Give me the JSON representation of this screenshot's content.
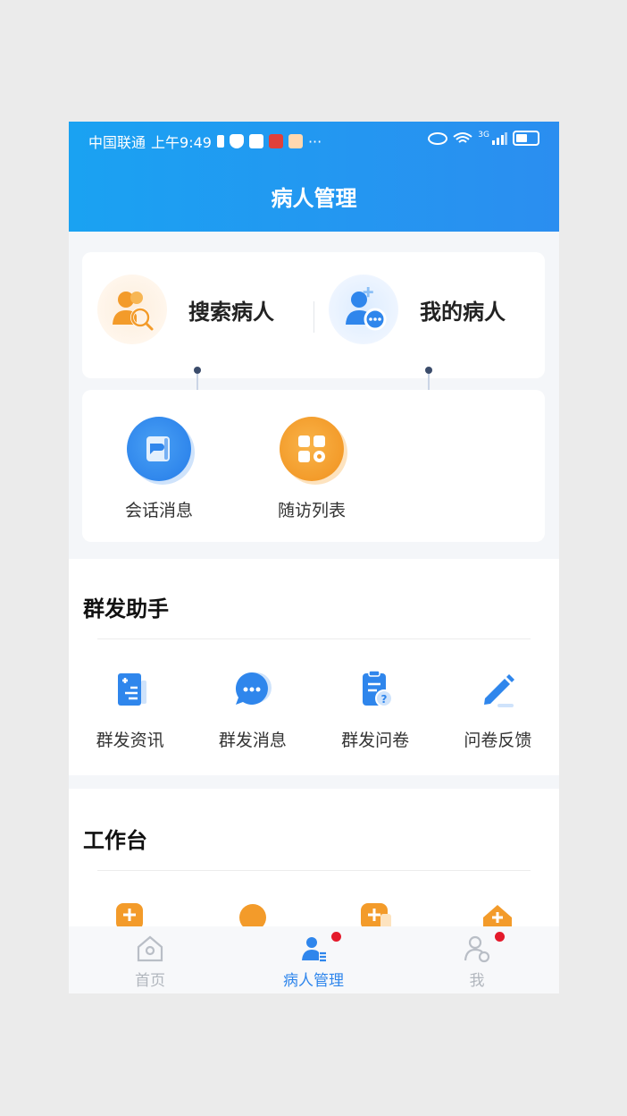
{
  "status_bar": {
    "carrier": "中国联通",
    "time": "上午9:49",
    "more": "···",
    "network": "3G"
  },
  "header": {
    "title": "病人管理"
  },
  "quick": {
    "search_patient": "搜索病人",
    "my_patients": "我的病人",
    "conversation": "会话消息",
    "followup_list": "随访列表"
  },
  "mass": {
    "title": "群发助手",
    "items": [
      {
        "label": "群发资讯",
        "icon": "document-list-icon"
      },
      {
        "label": "群发消息",
        "icon": "chat-bubble-icon"
      },
      {
        "label": "群发问卷",
        "icon": "clipboard-question-icon"
      },
      {
        "label": "问卷反馈",
        "icon": "pencil-icon"
      }
    ]
  },
  "workbench": {
    "title": "工作台"
  },
  "tabbar": {
    "home": "首页",
    "patients": "病人管理",
    "me": "我"
  },
  "colors": {
    "primary": "#2b8ef0",
    "accent_orange": "#f7a425",
    "badge": "#e41a2b"
  }
}
